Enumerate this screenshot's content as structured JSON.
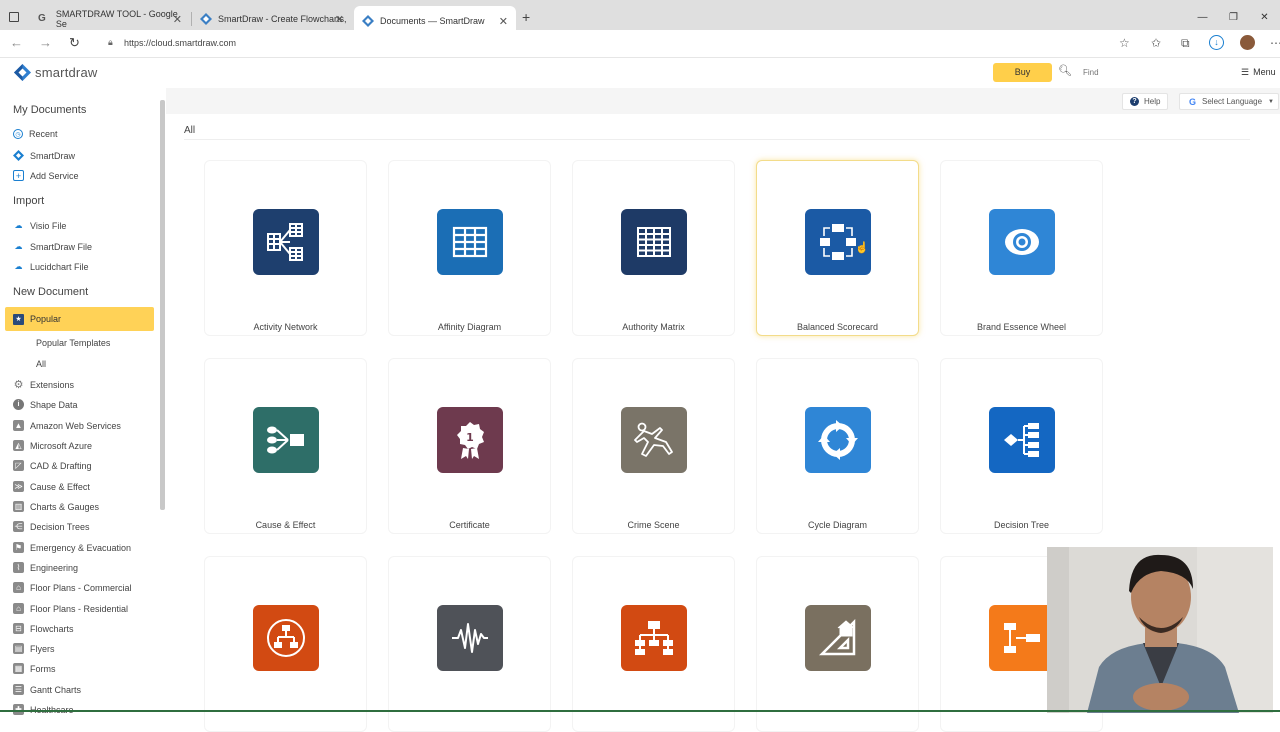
{
  "browser": {
    "tabs": [
      {
        "title": "SMARTDRAW TOOL - Google Se"
      },
      {
        "title": "SmartDraw - Create Flowcharts,"
      },
      {
        "title": "Documents — SmartDraw"
      }
    ],
    "new_tab": "+",
    "url": "https://cloud.smartdraw.com"
  },
  "header": {
    "logo_text": "smartdraw",
    "buy_label": "Buy",
    "search_placeholder": "Find",
    "menu_label": "Menu"
  },
  "sidebar": {
    "my_documents": {
      "title": "My Documents",
      "items": [
        {
          "label": "Recent"
        },
        {
          "label": "SmartDraw"
        },
        {
          "label": "Add Service"
        }
      ]
    },
    "import": {
      "title": "Import",
      "items": [
        {
          "label": "Visio File"
        },
        {
          "label": "SmartDraw File"
        },
        {
          "label": "Lucidchart File"
        }
      ]
    },
    "new_document": {
      "title": "New Document",
      "popular": "Popular",
      "sub": [
        {
          "label": "Popular Templates"
        },
        {
          "label": "All"
        }
      ],
      "categories": [
        {
          "label": "Extensions"
        },
        {
          "label": "Shape Data"
        },
        {
          "label": "Amazon Web Services"
        },
        {
          "label": "Microsoft Azure"
        },
        {
          "label": "CAD & Drafting"
        },
        {
          "label": "Cause & Effect"
        },
        {
          "label": "Charts & Gauges"
        },
        {
          "label": "Decision Trees"
        },
        {
          "label": "Emergency & Evacuation"
        },
        {
          "label": "Engineering"
        },
        {
          "label": "Floor Plans - Commercial"
        },
        {
          "label": "Floor Plans - Residential"
        },
        {
          "label": "Flowcharts"
        },
        {
          "label": "Flyers"
        },
        {
          "label": "Forms"
        },
        {
          "label": "Gantt Charts"
        },
        {
          "label": "Healthcare"
        }
      ]
    }
  },
  "main": {
    "help_label": "Help",
    "language_label": "Select Language",
    "section_title": "All",
    "templates": [
      {
        "label": "Activity Network",
        "color": "#1e3f6e",
        "icon": "activity-network-icon"
      },
      {
        "label": "Affinity Diagram",
        "color": "#1b6eb5",
        "icon": "affinity-diagram-icon"
      },
      {
        "label": "Authority Matrix",
        "color": "#1e3a66",
        "icon": "authority-matrix-icon"
      },
      {
        "label": "Balanced Scorecard",
        "color": "#1b5aa5",
        "icon": "balanced-scorecard-icon"
      },
      {
        "label": "Brand Essence Wheel",
        "color": "#2f86d6",
        "icon": "brand-essence-wheel-icon"
      },
      {
        "label": "Cause & Effect",
        "color": "#2e6e68",
        "icon": "cause-effect-icon"
      },
      {
        "label": "Certificate",
        "color": "#6e3a4e",
        "icon": "certificate-icon"
      },
      {
        "label": "Crime Scene",
        "color": "#7a7468",
        "icon": "crime-scene-icon"
      },
      {
        "label": "Cycle Diagram",
        "color": "#2f86d6",
        "icon": "cycle-diagram-icon"
      },
      {
        "label": "Decision Tree",
        "color": "#1467c2",
        "icon": "decision-tree-icon"
      },
      {
        "label": "",
        "color": "#d24a12",
        "icon": "ecomap-icon"
      },
      {
        "label": "",
        "color": "#4f5258",
        "icon": "waveform-icon"
      },
      {
        "label": "",
        "color": "#d24a12",
        "icon": "org-chart-icon"
      },
      {
        "label": "",
        "color": "#7a7060",
        "icon": "floor-plan-icon"
      },
      {
        "label": "",
        "color": "#f47a1a",
        "icon": "flowchart-icon"
      }
    ]
  }
}
